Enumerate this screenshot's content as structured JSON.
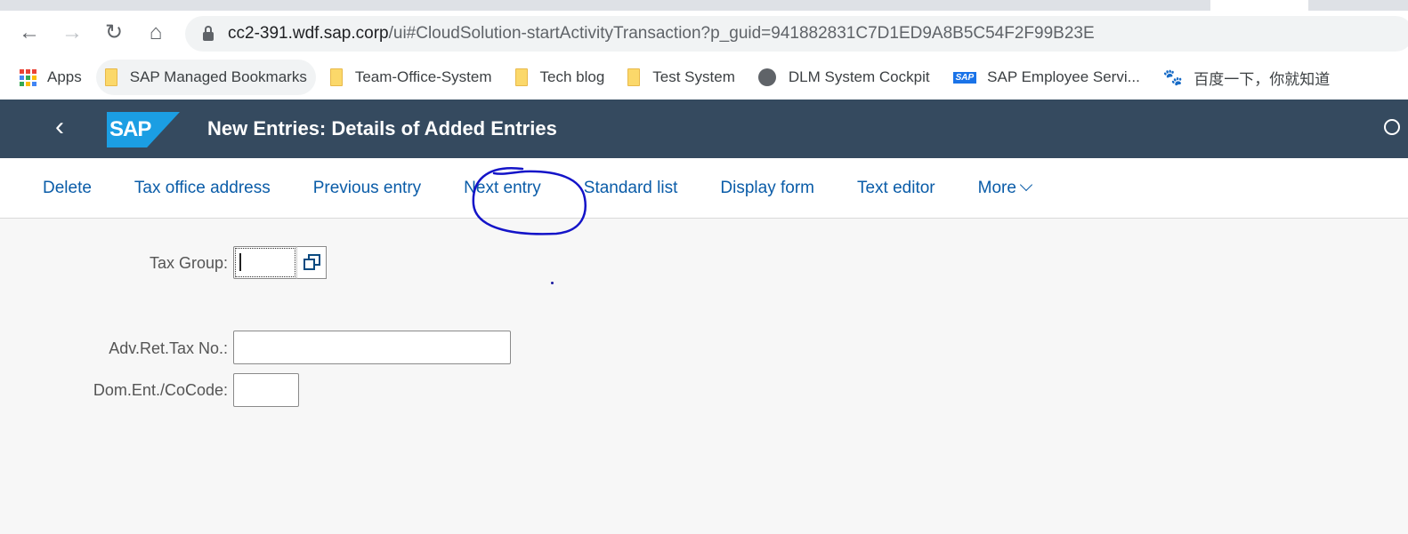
{
  "browser": {
    "url_host": "cc2-391.wdf.sap.corp",
    "url_rest": "/ui#CloudSolution-startActivityTransaction?p_guid=941882831C7D1ED9A8B5C54F2F99B23E",
    "bookmarks": [
      {
        "label": "Apps",
        "icon": "apps-grid-icon"
      },
      {
        "label": "SAP Managed Bookmarks",
        "icon": "folder-icon"
      },
      {
        "label": "Team-Office-System",
        "icon": "folder-icon"
      },
      {
        "label": "Tech blog",
        "icon": "folder-icon"
      },
      {
        "label": "Test System",
        "icon": "folder-icon"
      },
      {
        "label": "DLM System Cockpit",
        "icon": "globe-icon"
      },
      {
        "label": "SAP Employee Servi...",
        "icon": "sap-icon"
      },
      {
        "label": "百度一下，你就知道",
        "icon": "baidu-paw-icon"
      }
    ]
  },
  "shell": {
    "logo": "SAP",
    "title": "New Entries: Details of Added Entries"
  },
  "toolbar": {
    "items": [
      "Delete",
      "Tax office address",
      "Previous entry",
      "Next entry",
      "Standard list",
      "Display form",
      "Text editor",
      "More"
    ],
    "annotation_color": "#1414c8"
  },
  "form": {
    "tax_group": {
      "label": "Tax Group:",
      "value": ""
    },
    "adv_ret_tax_no": {
      "label": "Adv.Ret.Tax No.:",
      "value": ""
    },
    "dom_ent_cocode": {
      "label": "Dom.Ent./CoCode:",
      "value": ""
    }
  },
  "colors": {
    "shell_bg": "#354a5f",
    "link": "#0a5ca8",
    "sap_blue": "#1b9ee3"
  }
}
